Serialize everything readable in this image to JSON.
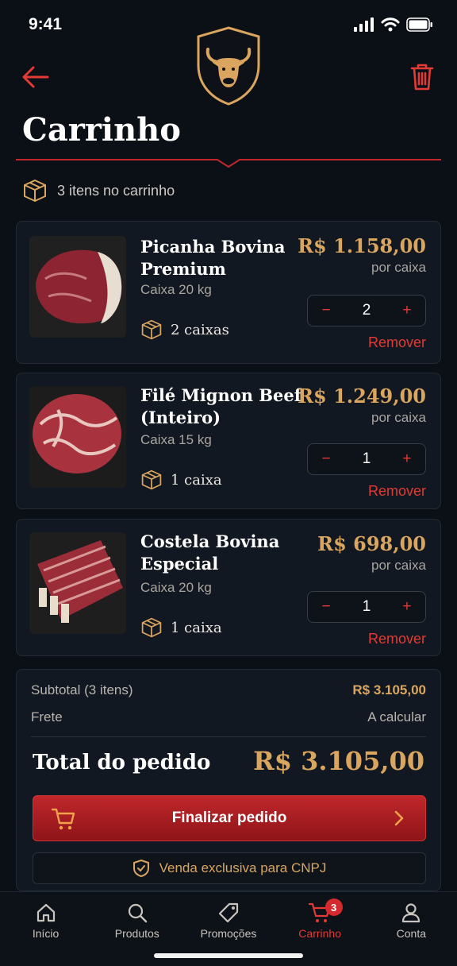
{
  "status": {
    "time": "9:41"
  },
  "header": {
    "title": "Carrinho"
  },
  "cart": {
    "count_label": "3 itens no carrinho"
  },
  "items": [
    {
      "name_line1": "Picanha Bovina",
      "name_line2": "Premium",
      "box": "Caixa 20 kg",
      "qty_label": "2 caixas",
      "price": "R$ 1.158,00",
      "per": "por caixa",
      "qty": "2",
      "remove": "Remover"
    },
    {
      "name_line1": "Filé Mignon Beef",
      "name_line2": "(Inteiro)",
      "box": "Caixa 15 kg",
      "qty_label": "1 caixa",
      "price": "R$ 1.249,00",
      "per": "por caixa",
      "qty": "1",
      "remove": "Remover"
    },
    {
      "name_line1": "Costela Bovina",
      "name_line2": "Especial",
      "box": "Caixa 20 kg",
      "qty_label": "1 caixa",
      "price": "R$ 698,00",
      "per": "por caixa",
      "qty": "1",
      "remove": "Remover"
    }
  ],
  "summary": {
    "subtotal_label": "Subtotal (3 itens)",
    "subtotal_value": "R$ 3.105,00",
    "shipping_label": "Frete",
    "shipping_value": "A calcular",
    "total_label": "Total do pedido",
    "total_value": "R$ 3.105,00",
    "checkout_label": "Finalizar pedido",
    "cnpj_label": "Venda exclusiva para CNPJ"
  },
  "tabs": [
    {
      "label": "Início",
      "icon": "home-icon"
    },
    {
      "label": "Produtos",
      "icon": "search-icon"
    },
    {
      "label": "Promoções",
      "icon": "tag-icon"
    },
    {
      "label": "Carrinho",
      "icon": "cart-icon",
      "badge": "3"
    },
    {
      "label": "Conta",
      "icon": "user-icon"
    }
  ],
  "colors": {
    "accent_red": "#e23a35",
    "gold": "#d9a55f",
    "background": "#0b0f16"
  }
}
